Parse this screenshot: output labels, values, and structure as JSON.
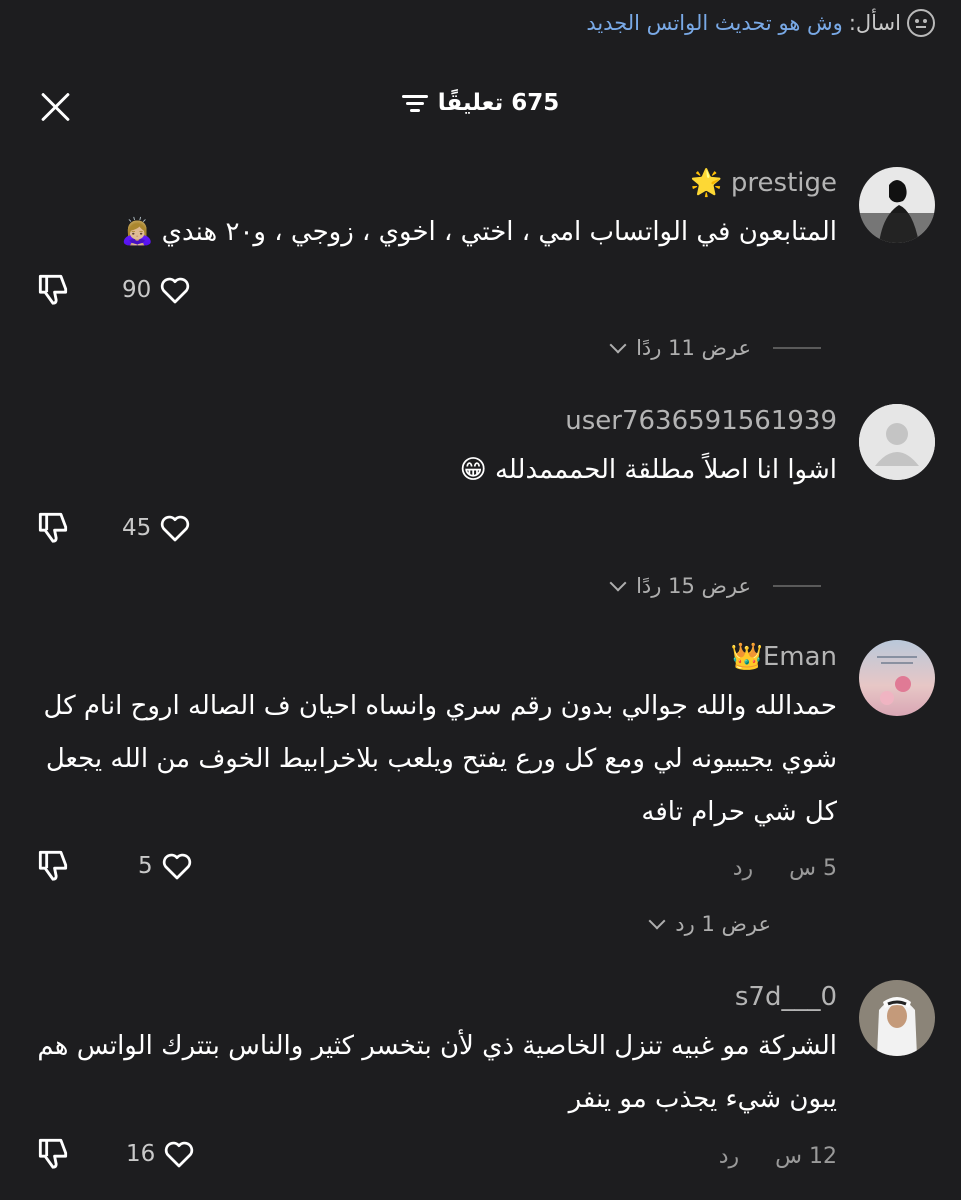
{
  "search": {
    "label": "اسأل:",
    "query": "وش هو تحديث الواتس الجديد"
  },
  "header": {
    "title": "675 تعليقًا"
  },
  "comments": [
    {
      "username": "prestige",
      "badge": "🌟",
      "text": "المتابعون في الواتساب امي ، اختي ، اخوي ، زوجي ، و٢٠ هندي 🙇🏼‍♀️",
      "likes": "90",
      "view_replies": "عرض 11 ردًا"
    },
    {
      "username": "user7636591561939",
      "text": "اشوا انا اصلاً مطلقة الحمممدلله 😁",
      "likes": "45",
      "view_replies": "عرض 15 ردًا"
    },
    {
      "username": "Eman",
      "badge": "👑",
      "text": "حمدالله والله جوالي بدون رقم سري وانساه احيان ف الصاله اروح انام كل شوي يجيبيونه لي ومع كل ورع يفتح ويلعب بلاخرابيط الخوف من الله يجعل كل شي حرام تافه",
      "likes": "5",
      "time": "5 س",
      "reply": "رد",
      "view_replies": "عرض 1 رد"
    },
    {
      "username": "s7d___0",
      "text": "الشركة مو غبيه تنزل الخاصية ذي لأن بتخسر كثير والناس بتترك الواتس هم يبون شيء يجذب مو ينفر",
      "likes": "16",
      "time": "12 س",
      "reply": "رد"
    }
  ],
  "colors": {
    "background": "#1d1d1f",
    "link": "#79a9e6",
    "muted": "#9a9a9a"
  },
  "icons": [
    "question-icon",
    "close-icon",
    "filter-icon",
    "heart-icon",
    "dislike-icon",
    "chevron-down-icon"
  ]
}
